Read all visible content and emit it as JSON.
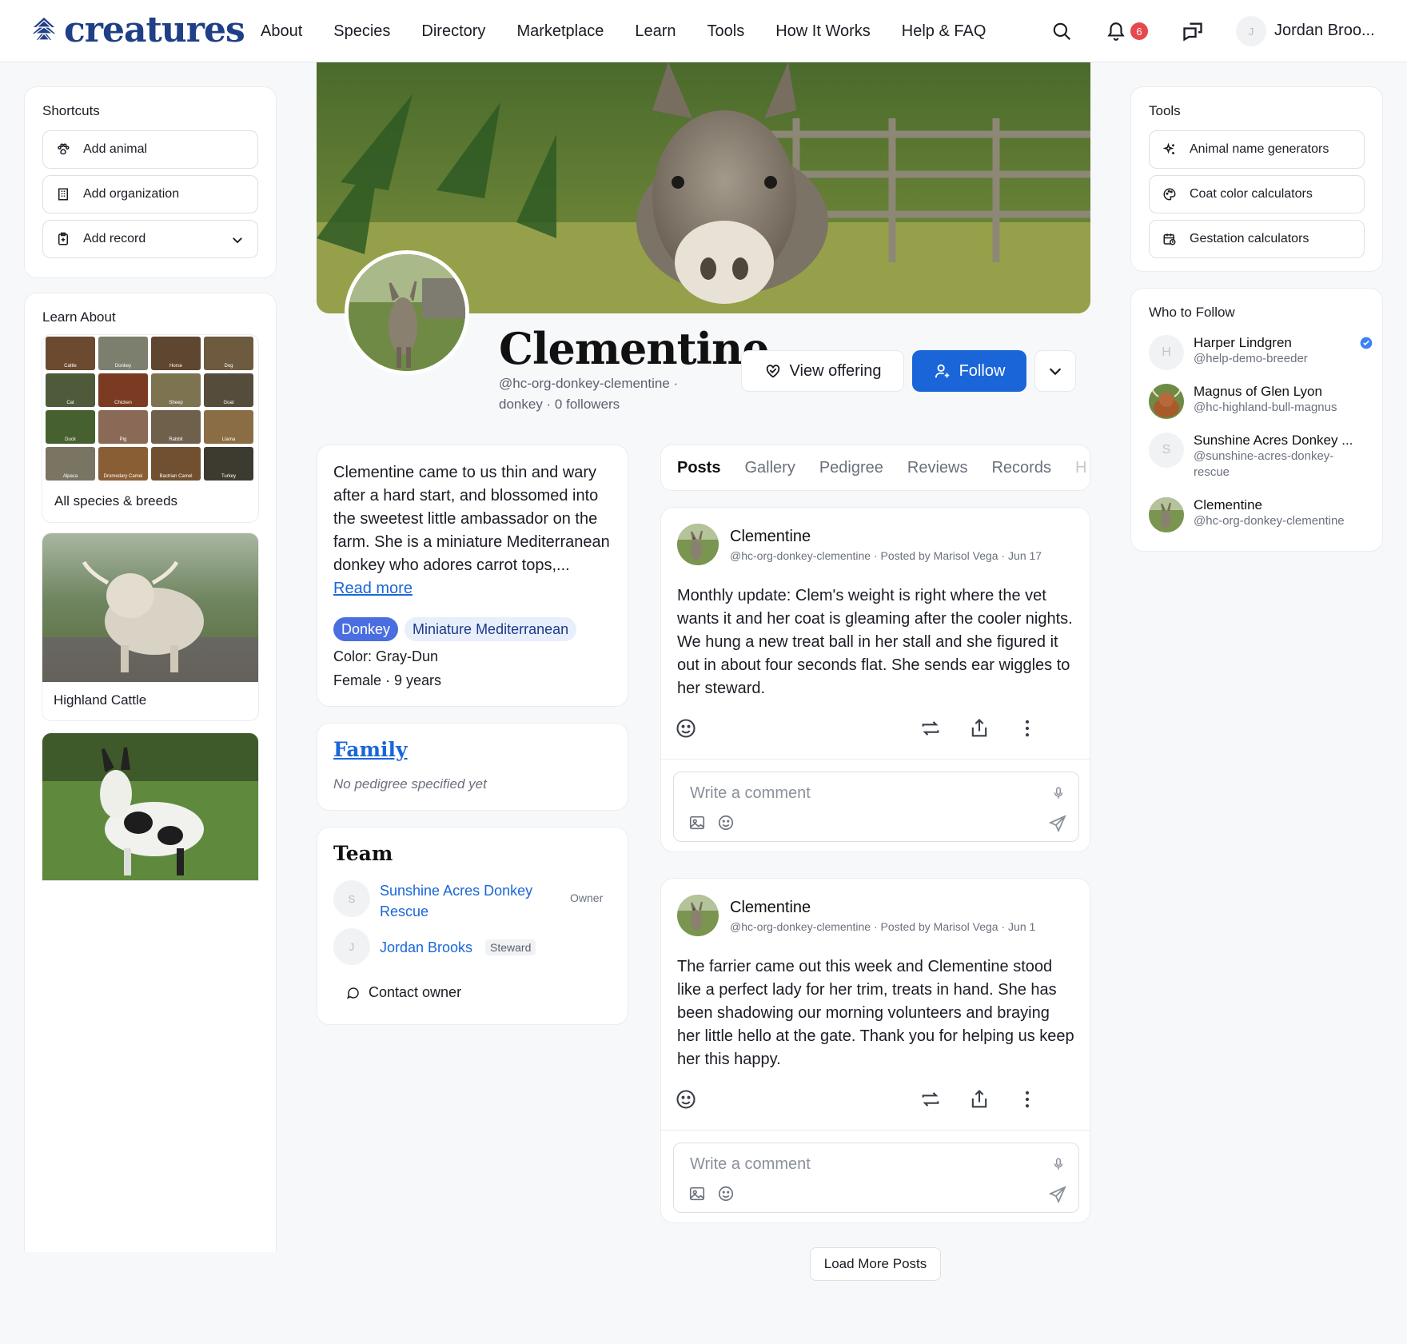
{
  "brand": {
    "name": "creatures",
    "color": "#1f3f86"
  },
  "nav": {
    "items": [
      "About",
      "Species",
      "Directory",
      "Marketplace",
      "Learn",
      "Tools",
      "How It Works",
      "Help & FAQ"
    ]
  },
  "header": {
    "notification_count": "6",
    "user_initial": "J",
    "user_name": "Jordan Broo..."
  },
  "shortcuts": {
    "title": "Shortcuts",
    "add_animal": "Add animal",
    "add_organization": "Add organization",
    "add_record": "Add record"
  },
  "learn": {
    "title": "Learn About",
    "species": [
      "Cattle",
      "Donkey",
      "Horse",
      "Dog",
      "Cat",
      "Chicken",
      "Sheep",
      "Goat",
      "Duck",
      "Pig",
      "Rabbit",
      "Llama",
      "Alpaca",
      "Dromedary Camel",
      "Bactrian Camel",
      "Turkey"
    ],
    "all_label": "All species & breeds",
    "card1": "Highland Cattle"
  },
  "profile": {
    "name": "Clementine",
    "handle_line": "@hc-org-donkey-clementine ·",
    "meta_line": "donkey · 0 followers",
    "view_offering": "View offering",
    "follow": "Follow"
  },
  "about": {
    "text": "Clementine came to us thin and wary after a hard start, and blossomed into the sweetest little ambassador on the farm. She is a miniature Mediterranean donkey who adores carrot tops,...",
    "read_more": "Read more",
    "tag_species": "Donkey",
    "tag_breed": "Miniature Mediterranean",
    "color": "Color: Gray-Dun",
    "sex_age": "Female · 9 years"
  },
  "family": {
    "title": "Family",
    "empty": "No pedigree specified yet"
  },
  "team": {
    "title": "Team",
    "members": [
      {
        "initial": "S",
        "name": "Sunshine Acres Donkey Rescue",
        "role": "Owner"
      },
      {
        "initial": "J",
        "name": "Jordan Brooks",
        "role": "Steward"
      }
    ],
    "contact": "Contact owner"
  },
  "tabs": [
    "Posts",
    "Gallery",
    "Pedigree",
    "Reviews",
    "Records",
    "H"
  ],
  "posts": [
    {
      "author": "Clementine",
      "meta": "@hc-org-donkey-clementine · Posted by Marisol Vega · Jun 17",
      "body": "Monthly update: Clem's weight is right where the vet wants it and her coat is gleaming after the cooler nights. We hung a new treat ball in her stall and she figured it out in about four seconds flat. She sends ear wiggles to her steward.",
      "comment_placeholder": "Write a comment"
    },
    {
      "author": "Clementine",
      "meta": "@hc-org-donkey-clementine · Posted by Marisol Vega · Jun 1",
      "body": "The farrier came out this week and Clementine stood like a perfect lady for her trim, treats in hand. She has been shadowing our morning volunteers and braying her little hello at the gate. Thank you for helping us keep her this happy.",
      "comment_placeholder": "Write a comment"
    }
  ],
  "load_more": "Load More Posts",
  "tools": {
    "title": "Tools",
    "items": [
      "Animal name generators",
      "Coat color calculators",
      "Gestation calculators"
    ]
  },
  "who_to_follow": {
    "title": "Who to Follow",
    "people": [
      {
        "initial": "H",
        "name": "Harper Lindgren",
        "handle": "@help-demo-breeder",
        "verified": true
      },
      {
        "initial": "",
        "name": "Magnus of Glen Lyon",
        "handle": "@hc-highland-bull-magnus"
      },
      {
        "initial": "S",
        "name": "Sunshine Acres Donkey ...",
        "handle": "@sunshine-acres-donkey-rescue"
      },
      {
        "initial": "",
        "name": "Clementine",
        "handle": "@hc-org-donkey-clementine"
      }
    ]
  },
  "colors": {
    "accent": "#1a66d9",
    "badge": "#e5484d",
    "tag_species_bg": "#4a6ee0",
    "tag_breed_bg": "#e8eefc",
    "verified": "#3b82f6"
  }
}
